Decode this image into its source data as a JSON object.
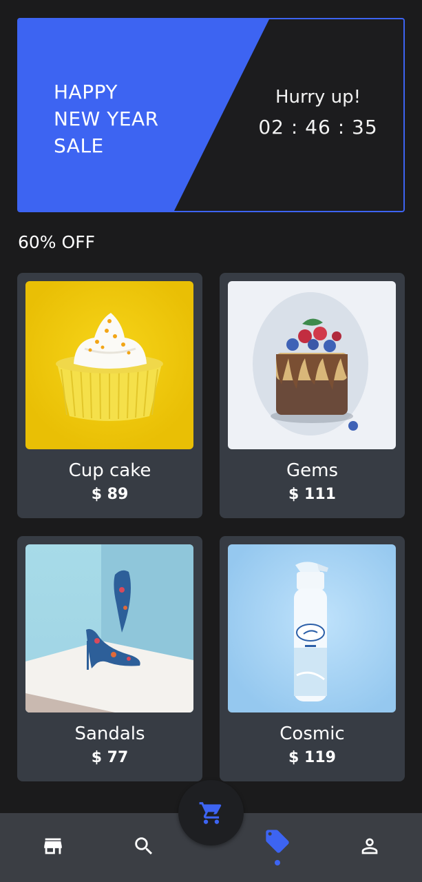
{
  "banner": {
    "title": "HAPPY\nNEW YEAR\nSALE",
    "hurry_text": "Hurry up!",
    "countdown": "02 : 46 : 35"
  },
  "section": {
    "title": "60% OFF"
  },
  "products": [
    {
      "name": "Cup cake",
      "price": "$ 89",
      "image": "cupcake-photo"
    },
    {
      "name": "Gems",
      "price": "$ 111",
      "image": "watercolor-cake-photo"
    },
    {
      "name": "Sandals",
      "price": "$ 77",
      "image": "floral-high-heels-photo"
    },
    {
      "name": "Cosmic",
      "price": "$ 119",
      "image": "air-freshener-photo"
    }
  ],
  "bottom_nav": {
    "items": [
      {
        "icon": "store-icon",
        "active": false
      },
      {
        "icon": "search-icon",
        "active": false
      },
      {
        "icon": "cart-icon",
        "active": false
      },
      {
        "icon": "tag-icon",
        "active": true
      },
      {
        "icon": "person-icon",
        "active": false
      }
    ]
  },
  "colors": {
    "background": "#1b1b1c",
    "accent": "#3d64f2",
    "card": "#373c44",
    "nav": "#3b3e44"
  }
}
